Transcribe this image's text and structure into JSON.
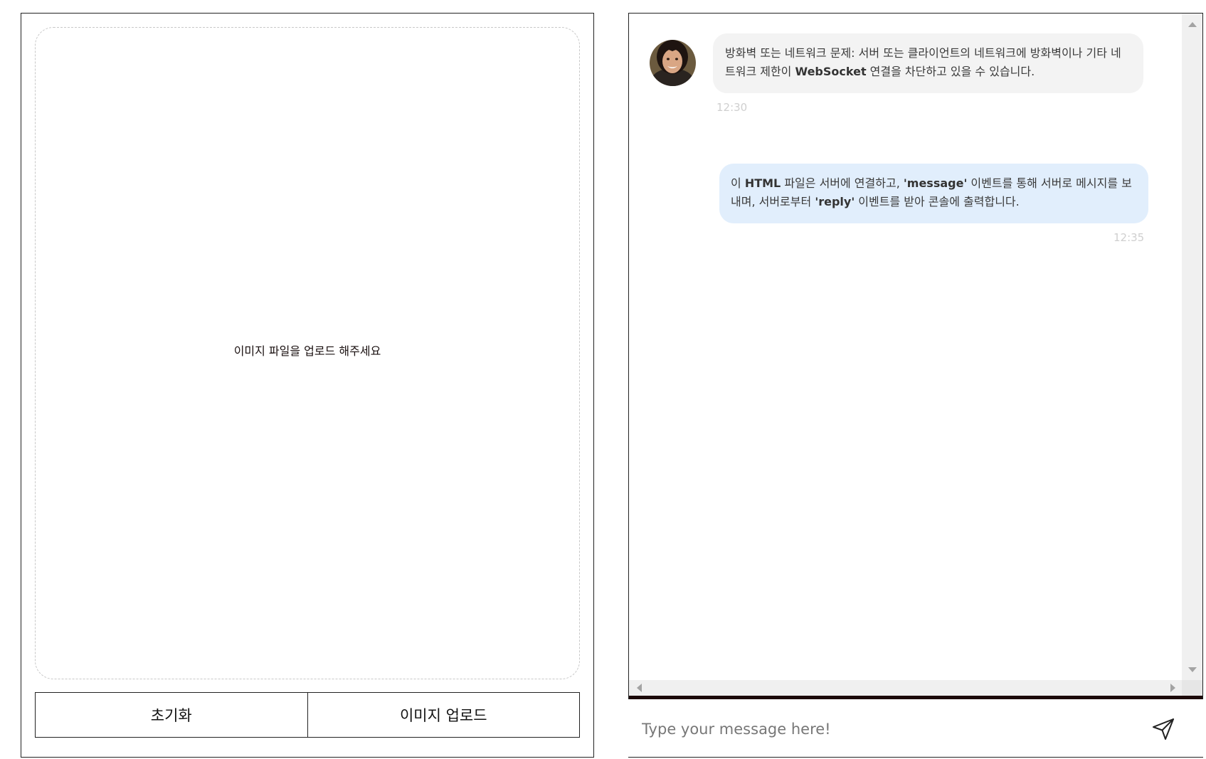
{
  "upload_panel": {
    "placeholder_text": "이미지 파일을 업로드 해주세요",
    "reset_button_label": "초기화",
    "upload_button_label": "이미지 업로드"
  },
  "chat": {
    "messages": [
      {
        "direction": "incoming",
        "avatar": "user-avatar-photo",
        "text_before": "방화벽 또는 네트워크 문제: 서버 또는 클라이언트의 네트워크에 방화벽이나 기타 네트워크 제한이 ",
        "text_bold": "WebSocket",
        "text_after": " 연결을 차단하고 있을 수 있습니다.",
        "time": "12:30"
      },
      {
        "direction": "outgoing",
        "text_1": "이 ",
        "bold_1": "HTML",
        "text_2": " 파일은 서버에 연결하고, ",
        "bold_2": "'message'",
        "text_3": " 이벤트를 통해 서버로 메시지를 보내며, 서버로부터 ",
        "bold_3": "'reply'",
        "text_4": " 이벤트를 받아 콘솔에 출력합니다.",
        "time": "12:35"
      }
    ],
    "input_placeholder": "Type your message here!",
    "send_icon": "paper-plane-icon"
  },
  "colors": {
    "incoming_bubble": "#f3f3f3",
    "outgoing_bubble": "#e1eefc",
    "timestamp": "#cfcfcf",
    "divider_bar": "#1c0a0a"
  }
}
